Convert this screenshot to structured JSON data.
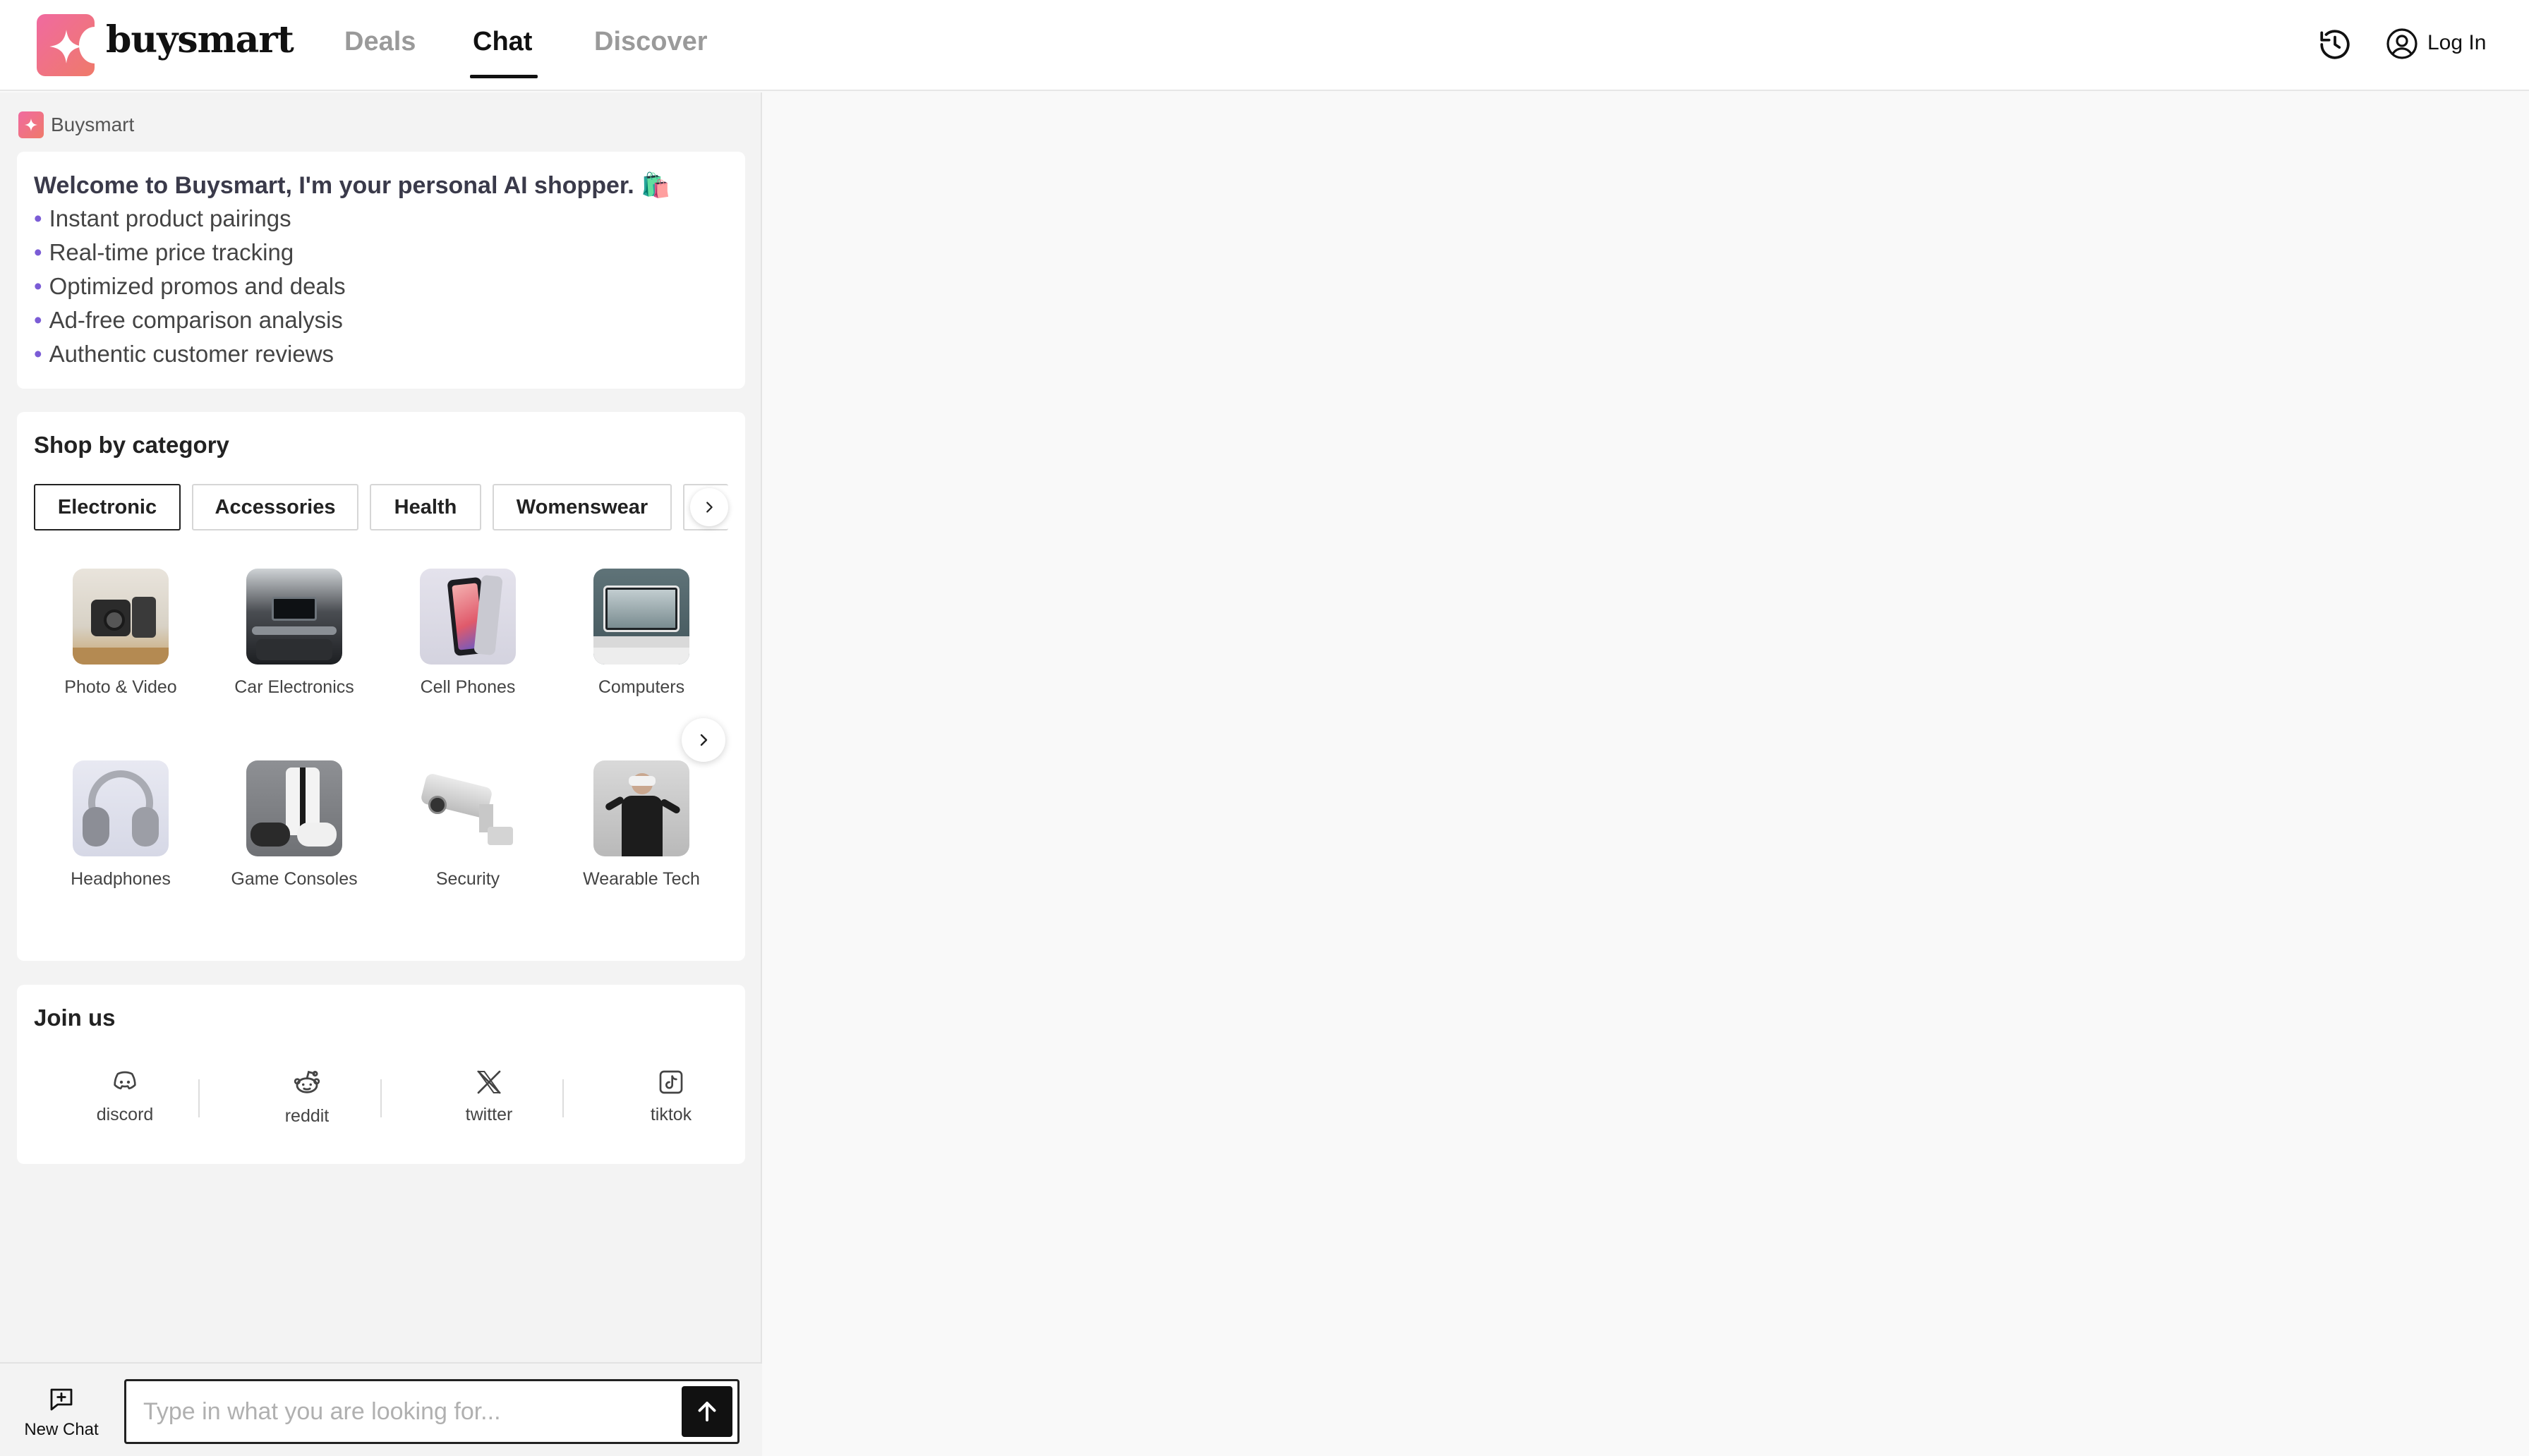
{
  "header": {
    "brand": "buysmart",
    "tabs": [
      {
        "label": "Deals",
        "active": false
      },
      {
        "label": "Chat",
        "active": true
      },
      {
        "label": "Discover",
        "active": false
      }
    ],
    "login_label": "Log In",
    "icons": [
      "history-icon",
      "user-icon"
    ]
  },
  "assistant": {
    "name": "Buysmart",
    "welcome_title": "Welcome to Buysmart, I'm your personal AI shopper. 🛍️",
    "features": [
      "Instant product pairings",
      "Real-time price tracking",
      "Optimized promos and deals",
      "Ad-free comparison analysis",
      "Authentic customer reviews"
    ]
  },
  "categories": {
    "title": "Shop by category",
    "chips": [
      {
        "label": "Electronic",
        "active": true
      },
      {
        "label": "Accessories",
        "active": false
      },
      {
        "label": "Health",
        "active": false
      },
      {
        "label": "Womenswear",
        "active": false
      }
    ],
    "items": [
      {
        "label": "Photo & Video"
      },
      {
        "label": "Car Electronics"
      },
      {
        "label": "Cell Phones"
      },
      {
        "label": "Computers"
      },
      {
        "label": "Headphones"
      },
      {
        "label": "Game Consoles"
      },
      {
        "label": "Security"
      },
      {
        "label": "Wearable Tech"
      }
    ]
  },
  "join": {
    "title": "Join us",
    "socials": [
      {
        "label": "discord",
        "icon": "discord-icon"
      },
      {
        "label": "reddit",
        "icon": "reddit-icon"
      },
      {
        "label": "twitter",
        "icon": "x-icon"
      },
      {
        "label": "tiktok",
        "icon": "tiktok-icon"
      }
    ]
  },
  "composer": {
    "new_chat_label": "New Chat",
    "placeholder": "Type in what you are looking for..."
  },
  "colors": {
    "brand_gradient_start": "#f06aa0",
    "brand_gradient_end": "#ef7a6a",
    "bullet": "#7b5cd6"
  }
}
